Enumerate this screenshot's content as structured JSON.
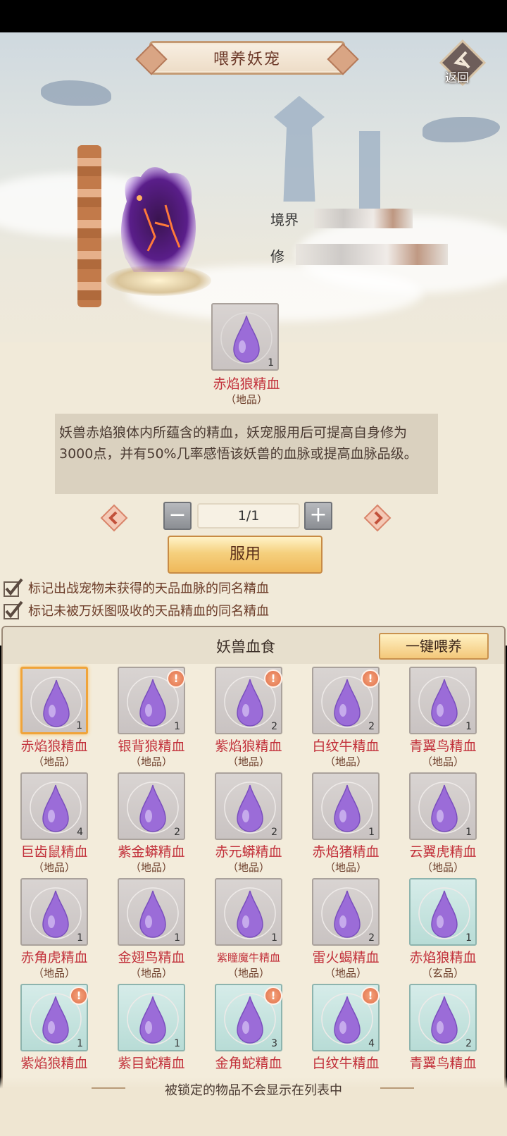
{
  "header": {
    "title": "喂养妖宠",
    "back_label": "返回"
  },
  "pet_stats": {
    "realm_label": "境界",
    "cultivation_label": "修"
  },
  "selected_item": {
    "name": "赤焰狼精血",
    "grade": "（地品）",
    "quantity": "1",
    "description": "妖兽赤焰狼体内所蕴含的精血，妖宠服用后可提高自身修为3000点，并有50%几率感悟该妖兽的血脉或提高血脉品级。"
  },
  "quantity_selector": {
    "value": "1/1",
    "minus": "−",
    "plus": "+"
  },
  "use_button": "服用",
  "options": [
    {
      "label": "标记出战宠物未获得的天品血脉的同名精血",
      "checked": true
    },
    {
      "label": "标记未被万妖图吸收的天品精血的同名精血",
      "checked": true
    }
  ],
  "list": {
    "title": "妖兽血食",
    "feed_all_button": "一键喂养",
    "items": [
      {
        "name": "赤焰狼精血",
        "grade": "（地品）",
        "qty": "1",
        "tier": "di",
        "warn": false,
        "selected": true
      },
      {
        "name": "银背狼精血",
        "grade": "（地品）",
        "qty": "1",
        "tier": "di",
        "warn": true,
        "selected": false
      },
      {
        "name": "紫焰狼精血",
        "grade": "（地品）",
        "qty": "2",
        "tier": "di",
        "warn": true,
        "selected": false
      },
      {
        "name": "白纹牛精血",
        "grade": "（地品）",
        "qty": "2",
        "tier": "di",
        "warn": true,
        "selected": false
      },
      {
        "name": "青翼鸟精血",
        "grade": "（地品）",
        "qty": "1",
        "tier": "di",
        "warn": false,
        "selected": false
      },
      {
        "name": "巨齿鼠精血",
        "grade": "（地品）",
        "qty": "4",
        "tier": "di",
        "warn": false,
        "selected": false
      },
      {
        "name": "紫金蟒精血",
        "grade": "（地品）",
        "qty": "2",
        "tier": "di",
        "warn": false,
        "selected": false
      },
      {
        "name": "赤元蟒精血",
        "grade": "（地品）",
        "qty": "2",
        "tier": "di",
        "warn": false,
        "selected": false
      },
      {
        "name": "赤焰猪精血",
        "grade": "（地品）",
        "qty": "1",
        "tier": "di",
        "warn": false,
        "selected": false
      },
      {
        "name": "云翼虎精血",
        "grade": "（地品）",
        "qty": "1",
        "tier": "di",
        "warn": false,
        "selected": false
      },
      {
        "name": "赤角虎精血",
        "grade": "（地品）",
        "qty": "1",
        "tier": "di",
        "warn": false,
        "selected": false
      },
      {
        "name": "金翅鸟精血",
        "grade": "（地品）",
        "qty": "1",
        "tier": "di",
        "warn": false,
        "selected": false
      },
      {
        "name": "紫瞳魔牛精血",
        "grade": "（地品）",
        "qty": "1",
        "tier": "di",
        "warn": false,
        "selected": false,
        "small": true
      },
      {
        "name": "雷火蝎精血",
        "grade": "（地品）",
        "qty": "2",
        "tier": "di",
        "warn": false,
        "selected": false
      },
      {
        "name": "赤焰狼精血",
        "grade": "（玄品）",
        "qty": "1",
        "tier": "xuan",
        "warn": false,
        "selected": false
      },
      {
        "name": "紫焰狼精血",
        "grade": "",
        "qty": "1",
        "tier": "xuan",
        "warn": true,
        "selected": false
      },
      {
        "name": "紫目蛇精血",
        "grade": "",
        "qty": "1",
        "tier": "xuan",
        "warn": false,
        "selected": false
      },
      {
        "name": "金角蛇精血",
        "grade": "",
        "qty": "3",
        "tier": "xuan",
        "warn": true,
        "selected": false
      },
      {
        "name": "白纹牛精血",
        "grade": "",
        "qty": "4",
        "tier": "xuan",
        "warn": true,
        "selected": false
      },
      {
        "name": "青翼鸟精血",
        "grade": "",
        "qty": "2",
        "tier": "xuan",
        "warn": false,
        "selected": false
      }
    ]
  },
  "footer_note": "被锁定的物品不会显示在列表中",
  "colors": {
    "item_name": "#c2303a",
    "grade_text": "#6b3c28",
    "selected_border": "#f0a43a",
    "drop_purple": "#9b6cd8"
  }
}
